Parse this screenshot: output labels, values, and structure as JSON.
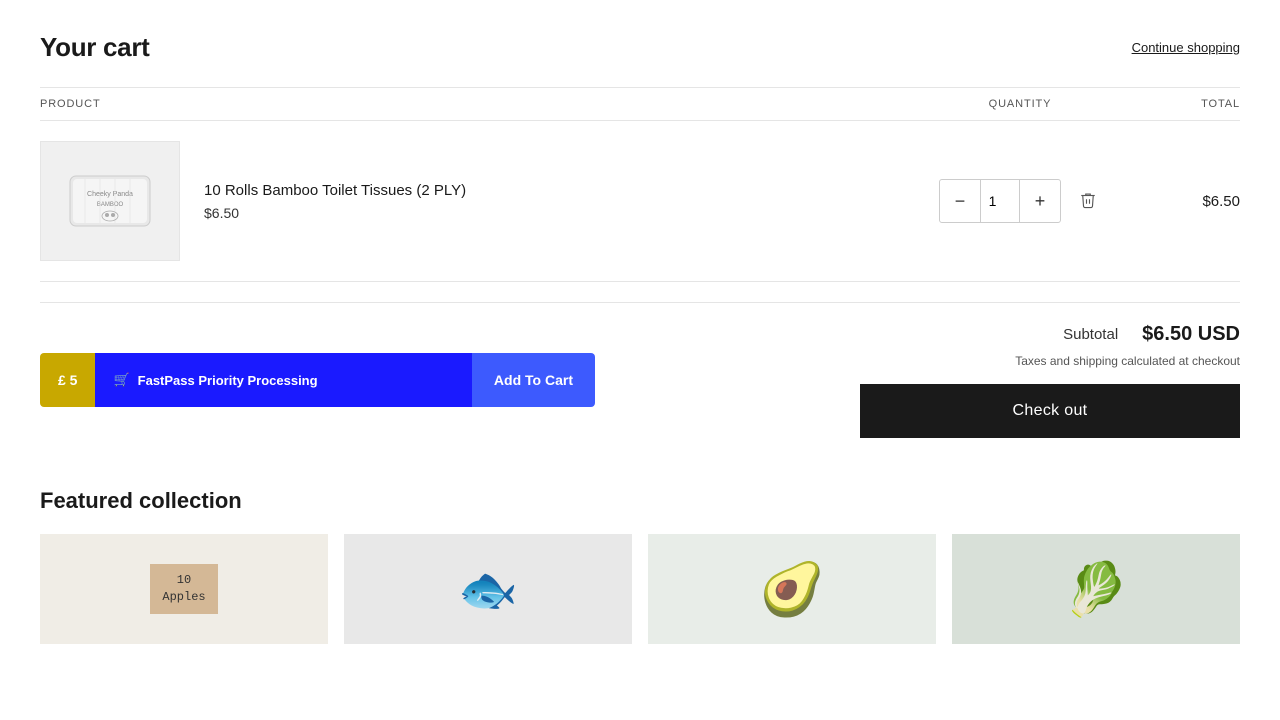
{
  "page": {
    "title": "Your cart",
    "continue_shopping": "Continue shopping"
  },
  "columns": {
    "product": "PRODUCT",
    "quantity": "QUANTITY",
    "total": "TOTAL"
  },
  "cart": {
    "items": [
      {
        "id": "item-1",
        "name": "10 Rolls Bamboo Toilet Tissues (2 PLY)",
        "price": "$6.50",
        "quantity": 1,
        "total": "$6.50"
      }
    ]
  },
  "summary": {
    "subtotal_label": "Subtotal",
    "subtotal_value": "$6.50 USD",
    "tax_note": "Taxes and shipping calculated at checkout",
    "checkout_label": "Check out"
  },
  "fastpass": {
    "badge_number": "£ 5",
    "label": "FastPass Priority Processing",
    "add_label": "Add To Cart",
    "cart_icon": "🛒"
  },
  "featured": {
    "title": "Featured collection",
    "items": [
      {
        "label_line1": "10",
        "label_line2": "Apples"
      },
      {
        "emoji": "🐟"
      },
      {
        "emoji": "🥑"
      },
      {
        "emoji": "🥬"
      }
    ]
  },
  "icons": {
    "minus": "−",
    "plus": "+",
    "delete": "🗑"
  }
}
